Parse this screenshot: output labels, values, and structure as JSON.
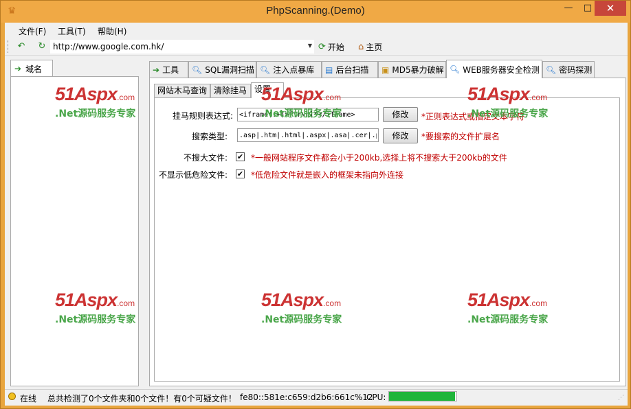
{
  "window": {
    "title": "PhpScanning.(Demo)",
    "min": "—",
    "max": "□",
    "close": "✕"
  },
  "menu": [
    "文件(F)",
    "工具(T)",
    "帮助(H)"
  ],
  "toolbar": {
    "url": "http://www.google.com.hk/",
    "start_label": "开始",
    "home_label": "主页"
  },
  "left": {
    "tab_label": "域名"
  },
  "main_tabs": [
    {
      "label": "工具",
      "icon": "arrow-icon"
    },
    {
      "label": "SQL漏洞扫描",
      "icon": "magnifier-icon"
    },
    {
      "label": "注入点暴库",
      "icon": "magnifier-icon"
    },
    {
      "label": "后台扫描",
      "icon": "window-icon"
    },
    {
      "label": "MD5暴力破解",
      "icon": "box-icon"
    },
    {
      "label": "WEB服务器安全检测",
      "icon": "magnifier-icon",
      "active": true
    },
    {
      "label": "密码探测",
      "icon": "magnifier-icon"
    }
  ],
  "sub_tabs": [
    {
      "label": "网站木马查询"
    },
    {
      "label": "清除挂马"
    },
    {
      "label": "设置",
      "active": true
    }
  ],
  "settings": {
    "rule_label": "挂马规则表达式:",
    "rule_value": "<iframe(.+)>[\\r\\n]*</iframe>",
    "rule_button": "修改",
    "rule_hint": "*正则表达式或指定文本字符",
    "types_label": "搜索类型:",
    "types_value": ".asp|.htm|.html|.aspx|.asa|.cer|.php",
    "types_button": "修改",
    "types_hint": "*要搜索的文件扩展名",
    "bigfile_label": "不搜大文件:",
    "bigfile_checked": true,
    "bigfile_hint": "*一般网站程序文件都会小于200kb,选择上将不搜索大于200kb的文件",
    "lowrisk_label": "不显示低危险文件:",
    "lowrisk_checked": true,
    "lowrisk_hint": "*低危险文件就是嵌入的框架未指向外连接"
  },
  "status": {
    "online": "在线",
    "summary": "总共检测了0个文件夹和0个文件！有0个可疑文件！",
    "ip": "fe80::581e:c659:d2b6:661c%12",
    "cpu_label": "CPU:",
    "cpu_fraction": 0.98
  },
  "watermark": {
    "brand": "51Aspx",
    "domain": ".com",
    "tagline": ".Net源码服务专家"
  },
  "colors": {
    "titlebar": "#f0a945",
    "close": "#c7463a",
    "hint_red": "#c00000",
    "cpu_green": "#1fb53a"
  }
}
